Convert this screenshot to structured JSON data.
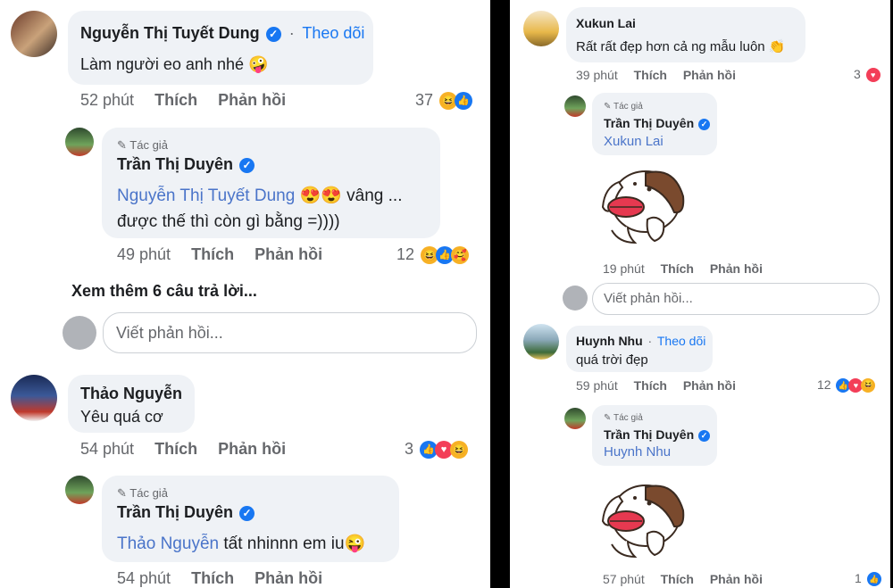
{
  "left": {
    "c1": {
      "name": "Nguyễn Thị Tuyết Dung",
      "follow": "Theo dõi",
      "text": "Làm người eo anh nhé",
      "emoji": "🤪",
      "time": "52 phút",
      "like": "Thích",
      "reply": "Phản hồi",
      "count": "37"
    },
    "c1r": {
      "tag": "Tác giả",
      "name": "Trần Thị Duyên",
      "mention": "Nguyễn Thị Tuyết Dung",
      "emoji": "😍😍",
      "text1": "vâng ...",
      "text2": "được thế thì còn gì bằng =))))",
      "time": "49 phút",
      "like": "Thích",
      "reply": "Phản hồi",
      "count": "12"
    },
    "more": "Xem thêm 6 câu trả lời...",
    "reply_input": {
      "placeholder": "Viết phản hồi..."
    },
    "c2": {
      "name": "Thảo Nguyễn",
      "text": "Yêu quá cơ",
      "time": "54 phút",
      "like": "Thích",
      "reply": "Phản hồi",
      "count": "3"
    },
    "c2r": {
      "tag": "Tác giả",
      "name": "Trần Thị Duyên",
      "mention": "Thảo Nguyễn",
      "text": "tất nhinnn em iu",
      "emoji": "😜",
      "time": "54 phút",
      "like": "Thích",
      "reply": "Phản hồi"
    }
  },
  "right": {
    "c1": {
      "name": "Xukun Lai",
      "text": "Rất rất đẹp hơn cả ng mẫu luôn",
      "emoji": "👏",
      "time": "39 phút",
      "like": "Thích",
      "reply": "Phản hồi",
      "count": "3"
    },
    "c1r": {
      "tag": "Tác giả",
      "name": "Trần Thị Duyên",
      "mention": "Xukun Lai",
      "time": "19 phút",
      "like": "Thích",
      "reply": "Phản hồi"
    },
    "reply_input": {
      "placeholder": "Viết phản hồi..."
    },
    "c2": {
      "name": "Huynh Nhu",
      "follow": "Theo dõi",
      "text": "quá trời đẹp",
      "time": "59 phút",
      "like": "Thích",
      "reply": "Phản hồi",
      "count": "12"
    },
    "c2r": {
      "tag": "Tác giả",
      "name": "Trần Thị Duyên",
      "mention": "Huynh Nhu",
      "time": "57 phút",
      "like": "Thích",
      "reply": "Phản hồi",
      "count": "1"
    }
  },
  "colors": {
    "accent": "#1877f2",
    "bubble": "#eff2f6",
    "mention": "#4a74c9",
    "meta": "#65676b"
  },
  "icons": [
    "verified-badge-icon",
    "pencil-icon",
    "like-reaction-icon",
    "love-reaction-icon",
    "haha-reaction-icon",
    "care-reaction-icon",
    "dog-sticker"
  ]
}
